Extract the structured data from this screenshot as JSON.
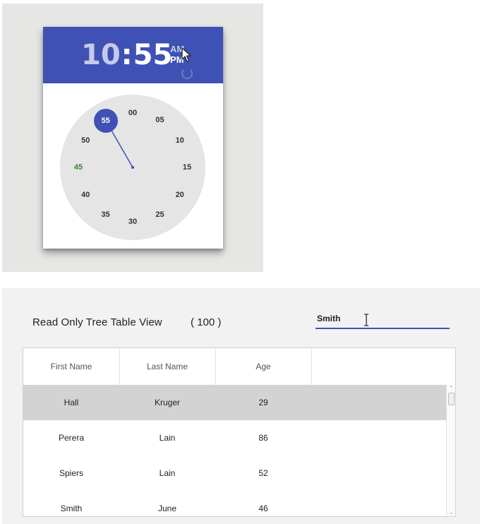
{
  "time_picker": {
    "hours": "10",
    "separator": ":",
    "minutes": "55",
    "am_label": "AM",
    "pm_label": "PM",
    "selected_period": "PM",
    "selected_minute": "55",
    "dial_labels": [
      "00",
      "05",
      "10",
      "15",
      "20",
      "25",
      "30",
      "35",
      "40",
      "45",
      "50",
      "55"
    ],
    "colors": {
      "header": "#3f51b5",
      "dial": "#e5e5e5",
      "selector": "#3f51b5"
    }
  },
  "tree_table": {
    "title": "Read Only Tree Table View",
    "count": "( 100 )",
    "search_value": "Smith",
    "columns": [
      "First Name",
      "Last Name",
      "Age"
    ],
    "rows": [
      {
        "first": "Hall",
        "last": "Kruger",
        "age": "29",
        "selected": true
      },
      {
        "first": "Perera",
        "last": "Lain",
        "age": "86",
        "selected": false
      },
      {
        "first": "Spiers",
        "last": "Lain",
        "age": "52",
        "selected": false
      },
      {
        "first": "Smith",
        "last": "June",
        "age": "46",
        "selected": false
      }
    ]
  }
}
